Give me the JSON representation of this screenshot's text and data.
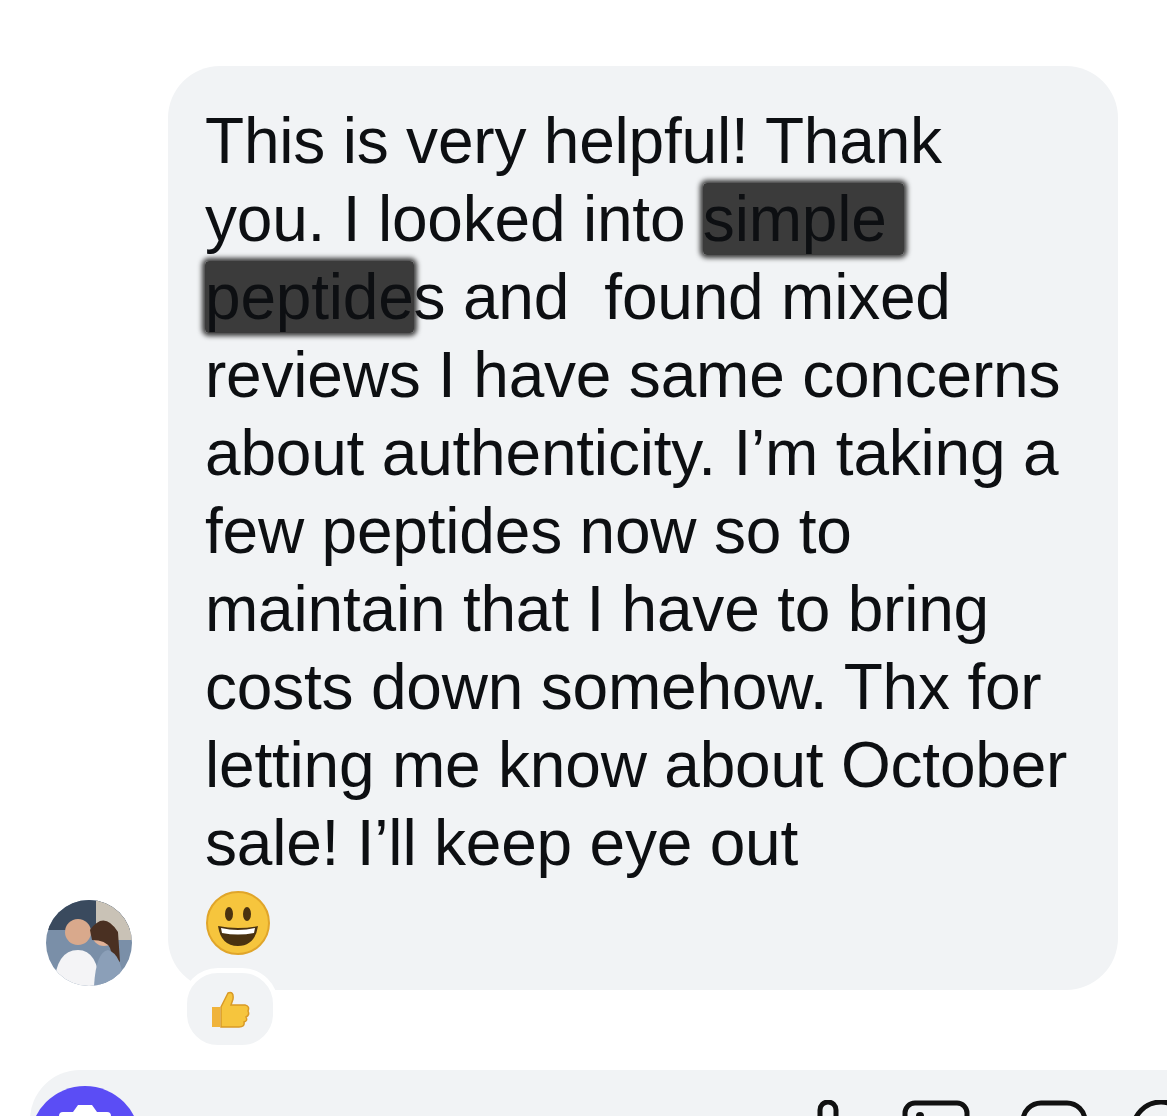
{
  "message": {
    "segments": [
      {
        "kind": "plain",
        "text": "This is very helpful! Thank you. I looked into "
      },
      {
        "kind": "redacted",
        "text": "simple peptide"
      },
      {
        "kind": "plain",
        "text": "s and  found mixed reviews I have same concerns about authenticity. I’m taking a few peptides now so to maintain that I have to bring costs down somehow. Thx for letting me know about October sale! I’ll keep eye out"
      }
    ],
    "emoji": {
      "kind": "smiley"
    },
    "reaction": {
      "kind": "thumbs_up"
    }
  }
}
